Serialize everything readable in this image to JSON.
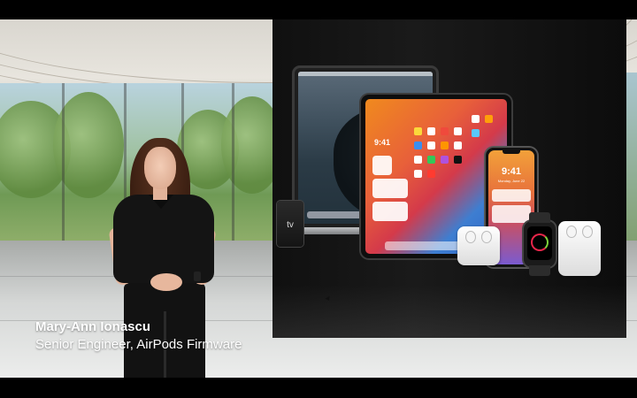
{
  "video": {
    "scene": "keynote-presentation",
    "lower_third": {
      "name": "Mary-Ann Ionascu",
      "title": "Senior Engineer, AirPods Firmware"
    },
    "devices": {
      "apple_tv_label": "tv",
      "ipad_time": "9:41",
      "iphone_time": "9:41",
      "iphone_date": "Monday, June 22"
    }
  },
  "colors": {
    "display_wall": "#121212",
    "caption_text": "#ffffff"
  }
}
